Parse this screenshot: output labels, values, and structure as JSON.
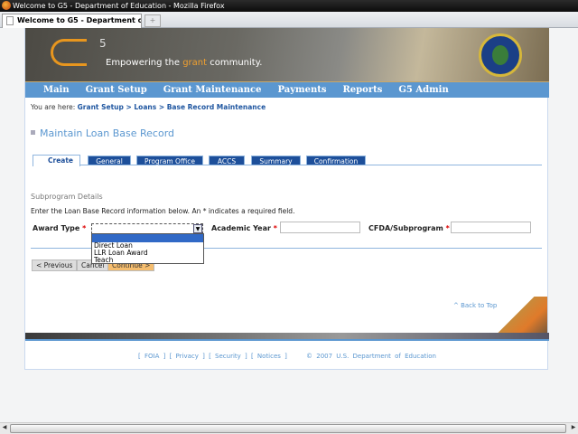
{
  "window": {
    "title": "Welcome to G5 - Department of Education - Mozilla Firefox",
    "tab_label": "Welcome to G5 - Department of Edu...",
    "new_tab": "+"
  },
  "banner": {
    "logo_sup": "5",
    "tagline_pre": "Empowering the ",
    "tagline_accent": "grant",
    "tagline_post": " community."
  },
  "nav": [
    "Main",
    "Grant Setup",
    "Grant Maintenance",
    "Payments",
    "Reports",
    "G5 Admin"
  ],
  "breadcrumb": {
    "prefix": "You are here:",
    "items": [
      "Grant Setup",
      "Loans",
      "Base Record Maintenance"
    ],
    "sep": " > "
  },
  "page_title": "Maintain Loan Base Record",
  "tabs": [
    "Create",
    "General",
    "Program Office",
    "ACCS",
    "Summary",
    "Confirmation"
  ],
  "form": {
    "section": "Subprogram Details",
    "instructions": "Enter the Loan Base Record information below. An * indicates a required field.",
    "required_mark": "*",
    "award_type_label": "Award Type",
    "award_type_value": "",
    "award_type_options": [
      "",
      "Direct Loan",
      "LLR Loan Award",
      "Teach"
    ],
    "academic_year_label": "Academic Year",
    "academic_year_value": "",
    "cfda_label": "CFDA/Subprogram",
    "cfda_value": ""
  },
  "buttons": {
    "previous": "< Previous",
    "cancel": "Cancel",
    "continue": "Continue >"
  },
  "back_to_top": "^ Back to Top",
  "footer": {
    "links": [
      "FOIA",
      "Privacy",
      "Security",
      "Notices"
    ],
    "copyright": "© 2007 U.S. Department of Education"
  },
  "colors": {
    "nav": "#5b97d0",
    "tab": "#1d4f9a",
    "accent": "#e8961e"
  }
}
